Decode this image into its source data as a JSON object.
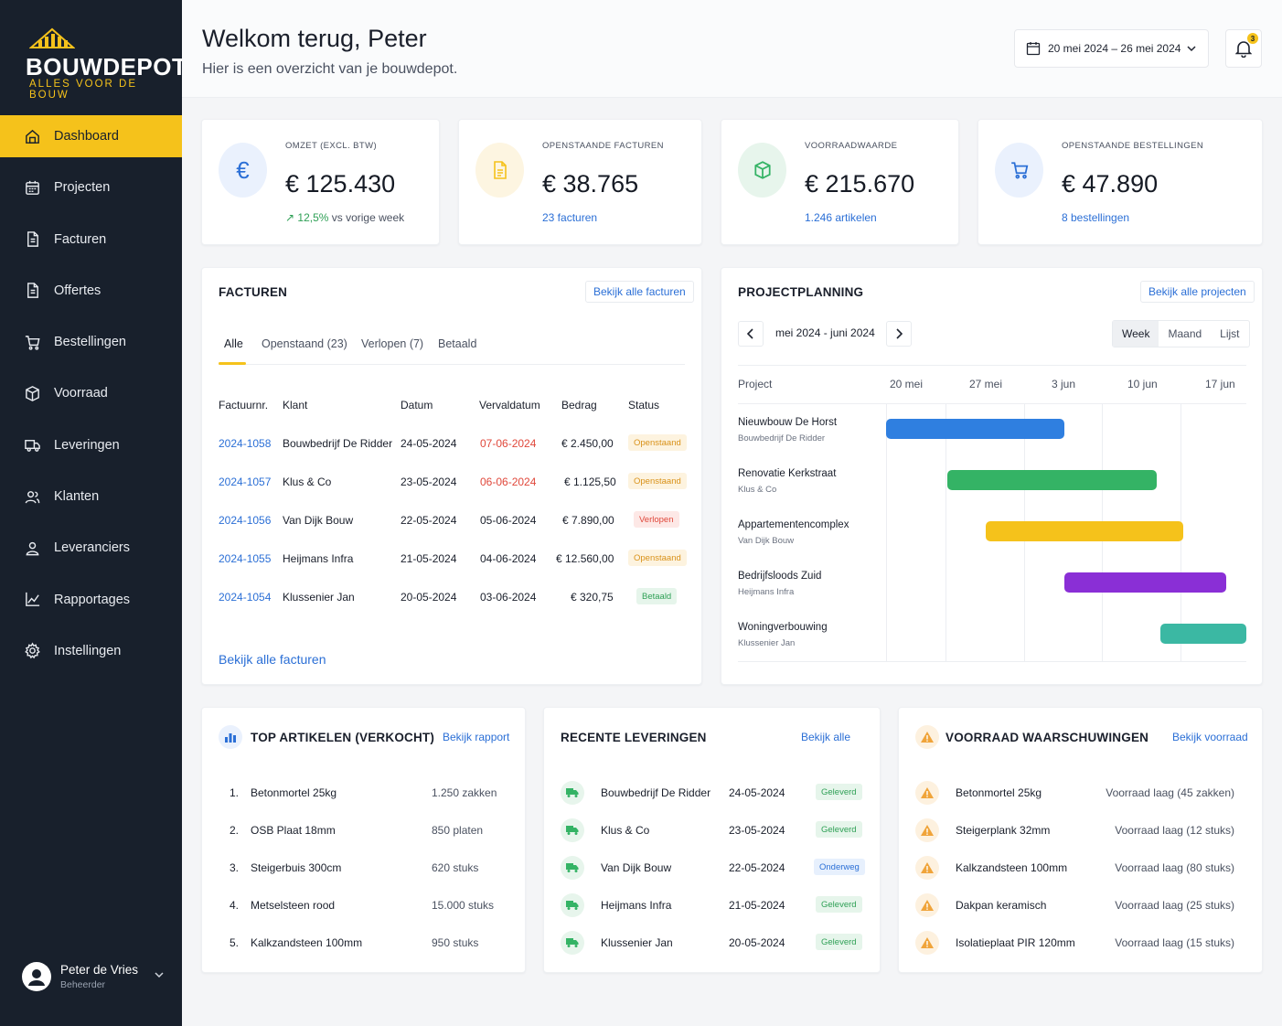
{
  "brand": {
    "name": "BOUWDEPOT",
    "tagline": "ALLES VOOR DE BOUW",
    "accent": "#f5c21b",
    "sidebar_bg": "#18202c"
  },
  "sidebar": {
    "items": [
      {
        "label": "Dashboard",
        "icon": "dashboard-icon",
        "active": true
      },
      {
        "label": "Projecten",
        "icon": "calendar-icon"
      },
      {
        "label": "Facturen",
        "icon": "document-icon"
      },
      {
        "label": "Offertes",
        "icon": "document-icon"
      },
      {
        "label": "Bestellingen",
        "icon": "cart-icon"
      },
      {
        "label": "Voorraad",
        "icon": "box-icon"
      },
      {
        "label": "Leveringen",
        "icon": "truck-icon"
      },
      {
        "label": "Klanten",
        "icon": "users-icon"
      },
      {
        "label": "Leveranciers",
        "icon": "user-icon"
      },
      {
        "label": "Rapportages",
        "icon": "chart-icon"
      },
      {
        "label": "Instellingen",
        "icon": "gear-icon"
      }
    ],
    "user": {
      "name": "Peter de Vries",
      "role": "Beheerder"
    }
  },
  "header": {
    "title": "Welkom terug, Peter",
    "subtitle": "Hier is een overzicht van je bouwdepot.",
    "date_range": "20 mei 2024 – 26 mei 2024",
    "notifications": "3"
  },
  "kpis": [
    {
      "label": "OMZET (EXCL. BTW)",
      "value": "€ 125.430",
      "trend": "12,5%",
      "trend_rest": "vs vorige week",
      "icon": "euro-icon"
    },
    {
      "label": "OPENSTAANDE FACTUREN",
      "value": "€ 38.765",
      "sub": "23 facturen",
      "icon": "document-icon"
    },
    {
      "label": "VOORRAADWAARDE",
      "value": "€ 215.670",
      "sub": "1.246 artikelen",
      "icon": "box-icon"
    },
    {
      "label": "OPENSTAANDE BESTELLINGEN",
      "value": "€ 47.890",
      "sub": "8 bestellingen",
      "icon": "cart-icon"
    }
  ],
  "invoices": {
    "title": "FACTUREN",
    "view_all": "Bekijk alle facturen",
    "tabs": [
      "Alle",
      "Openstaand (23)",
      "Verlopen (7)",
      "Betaald"
    ],
    "columns": [
      "Factuurnr.",
      "Klant",
      "Datum",
      "Vervaldatum",
      "Bedrag",
      "Status"
    ],
    "rows": [
      {
        "nr": "2024-1058",
        "client": "Bouwbedrijf De Ridder",
        "date": "24-05-2024",
        "due": "07-06-2024",
        "amount": "€ 2.450,00",
        "status": "Openstaand",
        "overdue": true
      },
      {
        "nr": "2024-1057",
        "client": "Klus & Co",
        "date": "23-05-2024",
        "due": "06-06-2024",
        "amount": "€ 1.125,50",
        "status": "Openstaand",
        "overdue": true
      },
      {
        "nr": "2024-1056",
        "client": "Van Dijk Bouw",
        "date": "22-05-2024",
        "due": "05-06-2024",
        "amount": "€ 7.890,00",
        "status": "Verlopen",
        "overdue": false
      },
      {
        "nr": "2024-1055",
        "client": "Heijmans Infra",
        "date": "21-05-2024",
        "due": "04-06-2024",
        "amount": "€ 12.560,00",
        "status": "Openstaand",
        "overdue": false
      },
      {
        "nr": "2024-1054",
        "client": "Klussenier Jan",
        "date": "20-05-2024",
        "due": "03-06-2024",
        "amount": "€ 320,75",
        "status": "Betaald",
        "overdue": false
      }
    ],
    "footer_link": "Bekijk alle facturen"
  },
  "planning": {
    "title": "PROJECTPLANNING",
    "view_all": "Bekijk alle projecten",
    "range": "mei 2024 - juni 2024",
    "views": [
      "Week",
      "Maand",
      "Lijst"
    ],
    "active_view": "Week",
    "column_header": "Project",
    "weeks": [
      "20 mei",
      "27 mei",
      "3 jun",
      "10 jun",
      "17 jun"
    ],
    "projects": [
      {
        "name": "Nieuwbouw De Horst",
        "client": "Bouwbedrijf De Ridder",
        "start": 0.0,
        "end": 2.27,
        "color": "#2f7fe0"
      },
      {
        "name": "Renovatie Kerkstraat",
        "client": "Klus & Co",
        "start": 0.78,
        "end": 3.44,
        "color": "#34b365"
      },
      {
        "name": "Appartementencomplex",
        "client": "Van Dijk Bouw",
        "start": 1.27,
        "end": 3.78,
        "color": "#f5c21b"
      },
      {
        "name": "Bedrijfsloods Zuid",
        "client": "Heijmans Infra",
        "start": 2.27,
        "end": 4.32,
        "color": "#8a2fd6"
      },
      {
        "name": "Woningverbouwing",
        "client": "Klussenier Jan",
        "start": 3.49,
        "end": 4.64,
        "color": "#3bb8a3"
      }
    ]
  },
  "top_articles": {
    "title": "TOP ARTIKELEN (VERKOCHT)",
    "link": "Bekijk rapport",
    "items": [
      {
        "rank": "1.",
        "name": "Betonmortel 25kg",
        "qty": "1.250 zakken"
      },
      {
        "rank": "2.",
        "name": "OSB Plaat 18mm",
        "qty": "850 platen"
      },
      {
        "rank": "3.",
        "name": "Steigerbuis 300cm",
        "qty": "620 stuks"
      },
      {
        "rank": "4.",
        "name": "Metselsteen rood",
        "qty": "15.000 stuks"
      },
      {
        "rank": "5.",
        "name": "Kalkzandsteen 100mm",
        "qty": "950 stuks"
      }
    ]
  },
  "deliveries": {
    "title": "RECENTE LEVERINGEN",
    "link": "Bekijk alle",
    "items": [
      {
        "name": "Bouwbedrijf De Ridder",
        "date": "24-05-2024",
        "status": "Geleverd"
      },
      {
        "name": "Klus & Co",
        "date": "23-05-2024",
        "status": "Geleverd"
      },
      {
        "name": "Van Dijk Bouw",
        "date": "22-05-2024",
        "status": "Onderweg"
      },
      {
        "name": "Heijmans Infra",
        "date": "21-05-2024",
        "status": "Geleverd"
      },
      {
        "name": "Klussenier Jan",
        "date": "20-05-2024",
        "status": "Geleverd"
      }
    ]
  },
  "stock_warnings": {
    "title": "VOORRAAD WAARSCHUWINGEN",
    "link": "Bekijk voorraad",
    "items": [
      {
        "name": "Betonmortel 25kg",
        "note": "Voorraad laag (45 zakken)"
      },
      {
        "name": "Steigerplank 32mm",
        "note": "Voorraad laag (12 stuks)"
      },
      {
        "name": "Kalkzandsteen 100mm",
        "note": "Voorraad laag (80 stuks)"
      },
      {
        "name": "Dakpan keramisch",
        "note": "Voorraad laag (25 stuks)"
      },
      {
        "name": "Isolatieplaat PIR 120mm",
        "note": "Voorraad laag (15 stuks)"
      }
    ]
  }
}
